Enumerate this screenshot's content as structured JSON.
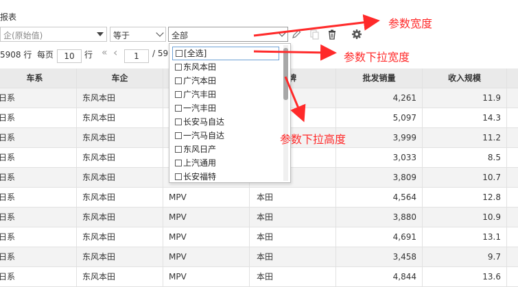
{
  "report": {
    "title": "报表"
  },
  "filters": {
    "company": {
      "placeholder": "企(原始值)"
    },
    "operator": {
      "value": "等于"
    },
    "param": {
      "value": "全部"
    }
  },
  "toolbar": {
    "icons": [
      "pencil-icon",
      "copy-icon",
      "trash-icon",
      "gear-icon"
    ]
  },
  "pager": {
    "total": "5908 行",
    "per_page_label": "每页",
    "per_page": "10",
    "rows_unit": "行",
    "first": "«",
    "prev": "‹",
    "page": "1",
    "page_total": "/ 59"
  },
  "table": {
    "columns": [
      "车系",
      "车企",
      "",
      "牌",
      "批发销量",
      "收入规模"
    ],
    "rows": [
      [
        "日系",
        "东风本田",
        "",
        "",
        "4,261",
        "11.9"
      ],
      [
        "日系",
        "东风本田",
        "",
        "",
        "5,097",
        "14.3"
      ],
      [
        "日系",
        "东风本田",
        "",
        "",
        "3,999",
        "11.2"
      ],
      [
        "日系",
        "东风本田",
        "",
        "",
        "3,033",
        "8.5"
      ],
      [
        "日系",
        "东风本田",
        "",
        "",
        "3,809",
        "10.7"
      ],
      [
        "日系",
        "东风本田",
        "MPV",
        "本田",
        "4,564",
        "12.8"
      ],
      [
        "日系",
        "东风本田",
        "MPV",
        "本田",
        "3,880",
        "10.9"
      ],
      [
        "日系",
        "东风本田",
        "MPV",
        "本田",
        "4,691",
        "13.1"
      ],
      [
        "日系",
        "东风本田",
        "MPV",
        "本田",
        "3,458",
        "9.7"
      ],
      [
        "日系",
        "东风本田",
        "MPV",
        "本田",
        "4,844",
        "13.6"
      ]
    ]
  },
  "dropdown": {
    "options": [
      "[全选]",
      "东风本田",
      "广汽本田",
      "广汽丰田",
      "一汽丰田",
      "长安马自达",
      "一汽马自达",
      "东风日产",
      "上汽通用",
      "长安福特"
    ]
  },
  "annotations": {
    "width": "参数宽度",
    "dropdown_width": "参数下拉宽度",
    "dropdown_height": "参数下拉高度",
    "color": "#ff2a2a"
  }
}
